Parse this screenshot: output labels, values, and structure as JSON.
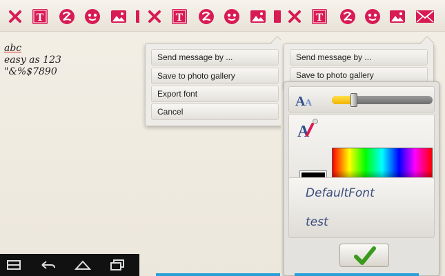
{
  "theme": {
    "accent": "#d81b54",
    "toolbar_icons": [
      "close-icon",
      "text-icon",
      "font-style-icon",
      "emoji-icon",
      "image-icon",
      "mail-icon"
    ]
  },
  "note": {
    "lines": [
      "abc",
      "easy as 123",
      "\"&%$7890"
    ]
  },
  "menu": {
    "items": [
      "Send message by ...",
      "Save to photo gallery",
      "Export font",
      "Cancel"
    ]
  },
  "font_dialog": {
    "size_level": 0.22,
    "selected_color": "#000000",
    "fonts": [
      "DefaultFont",
      "test"
    ],
    "ok_icon": "checkmark-icon"
  },
  "navbar": {
    "icons": [
      "recent-apps-icon",
      "back-icon",
      "home-icon",
      "recents-icon"
    ]
  }
}
